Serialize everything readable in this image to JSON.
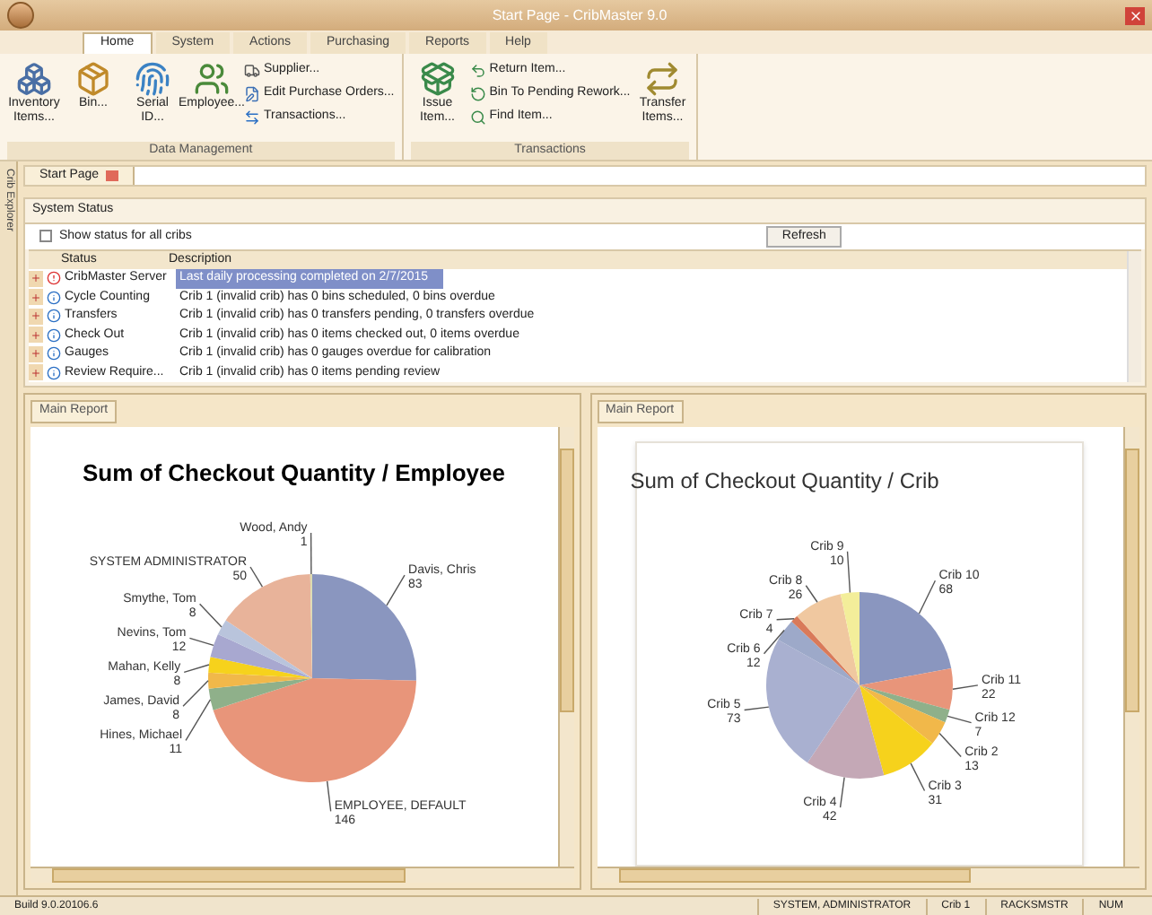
{
  "window": {
    "title": "Start Page - CribMaster 9.0"
  },
  "ribbon": {
    "tabs": [
      {
        "label": "Home",
        "selected": true
      },
      {
        "label": "System",
        "selected": false
      },
      {
        "label": "Actions",
        "selected": false
      },
      {
        "label": "Purchasing",
        "selected": false
      },
      {
        "label": "Reports",
        "selected": false
      },
      {
        "label": "Help",
        "selected": false
      }
    ],
    "groups": [
      {
        "label": "Data Management",
        "items": [
          {
            "label": "Inventory Items...",
            "kind": "large"
          },
          {
            "label": "Bin...",
            "kind": "large"
          },
          {
            "label": "Serial ID...",
            "kind": "large"
          },
          {
            "label": "Employee...",
            "kind": "large"
          },
          {
            "label": "Supplier...",
            "kind": "small"
          },
          {
            "label": "Edit Purchase Orders...",
            "kind": "small"
          },
          {
            "label": "Transactions...",
            "kind": "small"
          }
        ]
      },
      {
        "label": "Transactions",
        "items": [
          {
            "label": "Issue Item...",
            "kind": "large"
          },
          {
            "label": "Return Item...",
            "kind": "small"
          },
          {
            "label": "Bin To Pending Rework...",
            "kind": "small"
          },
          {
            "label": "Find Item...",
            "kind": "small"
          },
          {
            "label": "Transfer Items...",
            "kind": "large"
          }
        ]
      }
    ]
  },
  "document_tabs": [
    {
      "label": "Start Page",
      "selected": true
    }
  ],
  "side_panel": {
    "label": "Crib Explorer"
  },
  "system_status": {
    "title": "System Status",
    "show_all": {
      "label": "Show status for all cribs",
      "checked": false
    },
    "refresh": "Refresh",
    "columns": [
      "Status",
      "Description"
    ],
    "rows": [
      {
        "status": "CribMaster Server",
        "kind": "error",
        "description": "Last daily processing completed on 2/7/2015",
        "selected": true
      },
      {
        "status": "Cycle Counting",
        "kind": "info",
        "description": "Crib 1 (invalid crib) has 0 bins scheduled, 0 bins overdue",
        "selected": false
      },
      {
        "status": "Transfers",
        "kind": "info",
        "description": "Crib 1 (invalid crib) has 0 transfers pending, 0 transfers overdue",
        "selected": false
      },
      {
        "status": "Check Out",
        "kind": "info",
        "description": "Crib 1 (invalid crib) has 0 items checked out, 0 items overdue",
        "selected": false
      },
      {
        "status": "Gauges",
        "kind": "info",
        "description": "Crib 1 (invalid crib) has 0 gauges overdue for calibration",
        "selected": false
      },
      {
        "status": "Review Require...",
        "kind": "info",
        "description": "Crib 1 (invalid crib) has 0 items pending review",
        "selected": false
      }
    ]
  },
  "reports": [
    {
      "tab": "Main Report",
      "chart_data": {
        "type": "pie",
        "title": "Sum of Checkout Quantity / Employee",
        "categories": [
          "Davis, Chris",
          "EMPLOYEE, DEFAULT",
          "Hines, Michael",
          "James, David",
          "Mahan, Kelly",
          "Nevins, Tom",
          "Smythe, Tom",
          "SYSTEM ADMINISTRATOR",
          "Wood, Andy"
        ],
        "values": [
          83,
          146,
          11,
          8,
          8,
          12,
          8,
          50,
          1
        ],
        "data_labels": true
      }
    },
    {
      "tab": "Main Report",
      "chart_data": {
        "type": "pie",
        "title": "Sum of Checkout Quantity / Crib",
        "categories": [
          "Crib 10",
          "Crib 11",
          "Crib 12",
          "Crib 2",
          "Crib 3",
          "Crib 4",
          "Crib 5",
          "Crib 6",
          "Crib 7",
          "Crib 8",
          "Crib 9"
        ],
        "values": [
          68,
          22,
          7,
          13,
          31,
          42,
          73,
          12,
          4,
          26,
          10
        ],
        "data_labels": true
      }
    }
  ],
  "status_bar": {
    "build": "Build 9.0.20106.6",
    "fields": [
      "SYSTEM, ADMINISTRATOR",
      "Crib 1",
      "RACKSMSTR",
      "NUM"
    ]
  }
}
